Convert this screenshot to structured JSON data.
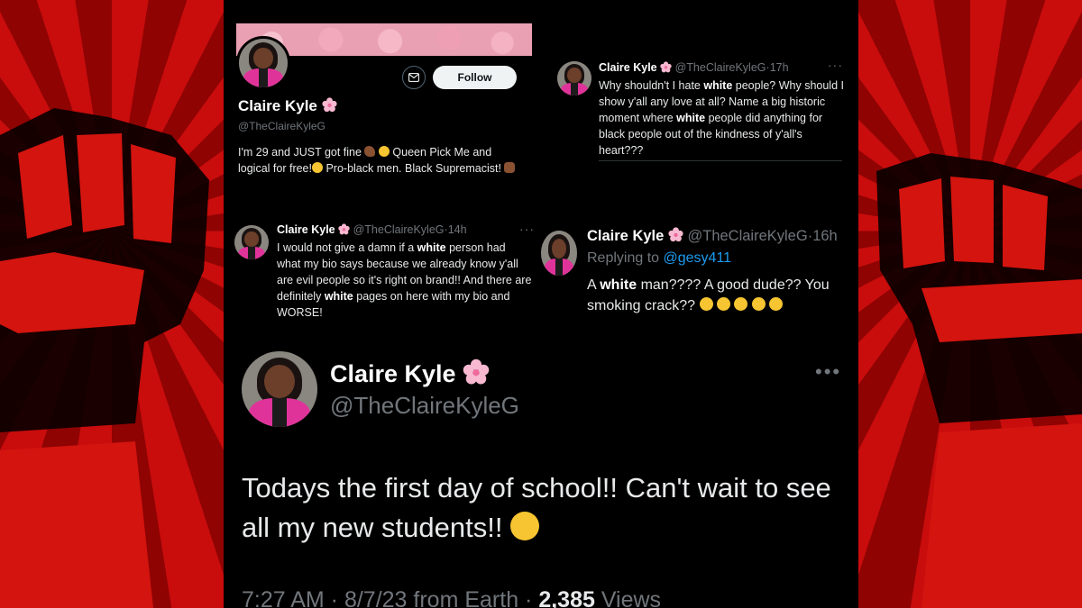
{
  "profile_card": {
    "name": "Claire Kyle",
    "handle": "@TheClaireKyleG",
    "follow_label": "Follow",
    "bio_parts": [
      "I'm 29 and JUST got fine ",
      " Queen Pick Me and logical for free!",
      " Pro-black men. Black Supremacist! "
    ],
    "icons": [
      "mail-icon",
      "cherry-blossom-icon",
      "flexed-bicep-icon",
      "star-struck-icon",
      "shushing-face-icon",
      "raised-fist-icon"
    ]
  },
  "tweet_top_right": {
    "name": "Claire Kyle",
    "handle": "@TheClaireKyleG",
    "time": "17h",
    "segments": [
      "Why shouldn't I hate ",
      "white",
      " people? Why should I show y'all any love at all? Name a big historic moment where ",
      "white",
      " people did anything for black people out of the kindness of y'all's heart???"
    ]
  },
  "tweet_middle_left": {
    "name": "Claire Kyle",
    "handle": "@TheClaireKyleG",
    "time": "14h",
    "segments": [
      "I would not give a damn if a ",
      "white",
      " person had what my bio says because we already know y'all are evil people so it's right on brand!! And there are definitely ",
      "white",
      " pages on here with my bio and WORSE!"
    ]
  },
  "tweet_middle_right": {
    "name": "Claire Kyle",
    "handle": "@TheClaireKyleG",
    "time": "16h",
    "replying_prefix": "Replying to ",
    "replying_to": "@gesy411",
    "segments": [
      "A ",
      "white",
      " man???? A good dude?? You smoking crack?? "
    ],
    "icons": [
      "rolling-laughing-icon",
      "tears-of-joy-icon"
    ]
  },
  "main_tweet": {
    "name": "Claire Kyle",
    "handle": "@TheClaireKyleG",
    "text": "Todays the first day of school!! Can't wait to see all my new students!! ",
    "footer_prefix": "7:27 AM · 8/7/23 from Earth · ",
    "views_count": "2,385",
    "views_label": " Views",
    "icons": [
      "star-struck-icon",
      "more-options-icon"
    ]
  },
  "colors": {
    "background_red": "#c90c0c",
    "background_dark_red": "#8f0303",
    "fist_black": "#0a0000",
    "text_primary": "#e7e9ea",
    "text_secondary": "#71767b",
    "link_blue": "#1d9bf0",
    "follow_button": "#eff3f4"
  }
}
